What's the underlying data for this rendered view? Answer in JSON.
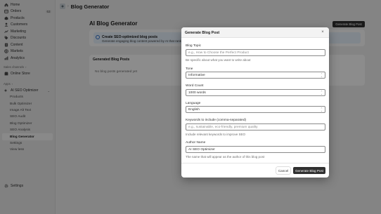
{
  "sidebar": {
    "items": [
      {
        "label": "Home",
        "icon": "home-icon"
      },
      {
        "label": "Orders",
        "icon": "orders-icon",
        "count": "63"
      },
      {
        "label": "Products",
        "icon": "products-icon"
      },
      {
        "label": "Customers",
        "icon": "customers-icon"
      },
      {
        "label": "Marketing",
        "icon": "marketing-icon"
      },
      {
        "label": "Discounts",
        "icon": "discounts-icon"
      },
      {
        "label": "Content",
        "icon": "content-icon"
      },
      {
        "label": "Markets",
        "icon": "markets-icon"
      },
      {
        "label": "Analytics",
        "icon": "analytics-icon"
      }
    ],
    "sales_channels_label": "Sales channels",
    "online_store": "Online Store",
    "apps_label": "Apps",
    "app_name": "AI SEO Optimizer",
    "app_sub_items": [
      "Products",
      "Bulk Optimizer",
      "Image Alt Text",
      "SEO Audit",
      "Blog Optimizer",
      "SEO Analysis",
      "Blog Generator",
      "Settings",
      "View less"
    ],
    "active_sub_item": "Blog Generator",
    "settings": "Settings"
  },
  "topbar": {
    "title": "Blog Generator"
  },
  "page": {
    "title": "AI Blog Generator",
    "primary_button": "Generate Blog Post",
    "banner_title": "Create SEO-optimized blog posts",
    "banner_text": "Generate engaging blog content powered by AI that ranks well in search engines and attracts your target audience",
    "generated_title": "Generated Blog Posts",
    "empty_text": "No blog posts generated yet"
  },
  "modal": {
    "title": "Generate Blog Post",
    "fields": {
      "topic": {
        "label": "Blog Topic",
        "placeholder": "e.g., How to Choose the Perfect Product",
        "help": "Be specific about what you want to write about"
      },
      "tone": {
        "label": "Tone",
        "value": "Informative"
      },
      "word_count": {
        "label": "Word Count",
        "value": "1000 words"
      },
      "language": {
        "label": "Language",
        "value": "English"
      },
      "keywords": {
        "label": "Keywords to include (comma-separated)",
        "placeholder": "e.g., sustainable, eco-friendly, premium quality",
        "help": "Include relevant keywords to improve SEO"
      },
      "author": {
        "label": "Author Name",
        "value": "AI SEO Optimizer",
        "help": "The name that will appear as the author of this blog post"
      }
    },
    "cancel": "Cancel",
    "submit": "Generate Blog Post"
  },
  "colors": {
    "primary_button": "#303030",
    "banner_bg": "#eaf4ff",
    "overlay": "rgba(0,0,0,0.45)"
  }
}
